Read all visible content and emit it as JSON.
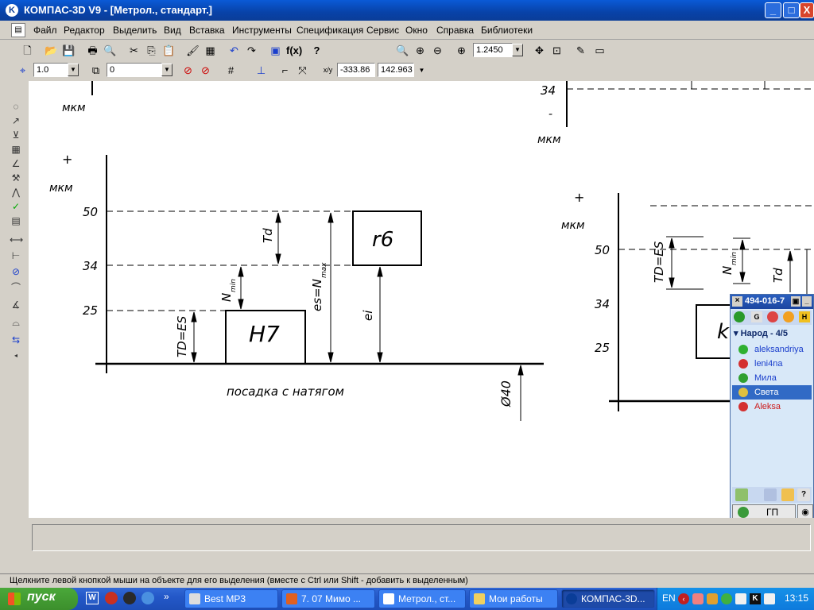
{
  "window": {
    "title": "КОМПАС-3D V9 - [Метрол., стандарт.]",
    "minimize": "_",
    "maximize": "□",
    "close": "X"
  },
  "menu": [
    "Файл",
    "Редактор",
    "Выделить",
    "Вид",
    "Вставка",
    "Инструменты",
    "Спецификация",
    "Сервис",
    "Окно",
    "Справка",
    "Библиотеки"
  ],
  "toolbar": {
    "zoom_value": "1.2450",
    "step_value": "1.0",
    "layer_value": "0",
    "coord_x": "-333.86",
    "coord_y": "142.963",
    "fx_label": "f(x)"
  },
  "drawing": {
    "left": {
      "plus": "+",
      "unit_top": "мкм",
      "unit_axis": "мкм",
      "ticks": [
        "50",
        "34",
        "25"
      ],
      "hole_label": "H7",
      "shaft_label": "r6",
      "dim_td": "TD=ES",
      "dim_nmin": "N",
      "dim_nmin_sub": "min",
      "dim_Td": "Td",
      "dim_es": "es=N",
      "dim_es_sub": "max",
      "dim_ei": "ei",
      "caption": "посадка с натягом",
      "diameter": "Ø40"
    },
    "right": {
      "tick_top": "34",
      "minus": "-",
      "unit_top": "мкм",
      "plus": "+",
      "unit_axis": "мкм",
      "ticks": [
        "50",
        "34",
        "25"
      ],
      "dim_td": "TD=ES",
      "dim_nmin": "N",
      "dim_nmin_sub": "min",
      "dim_Td": "Td",
      "hole_label": "k"
    }
  },
  "icq": {
    "uin": "494-016-7",
    "group": "Народ - 4/5",
    "contacts": [
      {
        "name": "aleksandriya",
        "color": "#1a3ecc"
      },
      {
        "name": "leni4na",
        "color": "#1a3ecc"
      },
      {
        "name": "Мила",
        "color": "#1a3ecc"
      },
      {
        "name": "Света",
        "color": "#ffffff"
      },
      {
        "name": "Aleksa",
        "color": "#cc1a1a"
      }
    ],
    "bottom_label": "ГП"
  },
  "status": {
    "hint": "Щелкните левой кнопкой мыши на объекте для его выделения (вместе с Ctrl или Shift - добавить к выделенным)"
  },
  "taskbar": {
    "start_label": "пуск",
    "items": [
      "Best MP3",
      "7. 07 Мимо ...",
      "Метрол., ст...",
      "Мои работы",
      "КОМПАС-3D..."
    ],
    "lang": "EN",
    "time": "13:15"
  }
}
